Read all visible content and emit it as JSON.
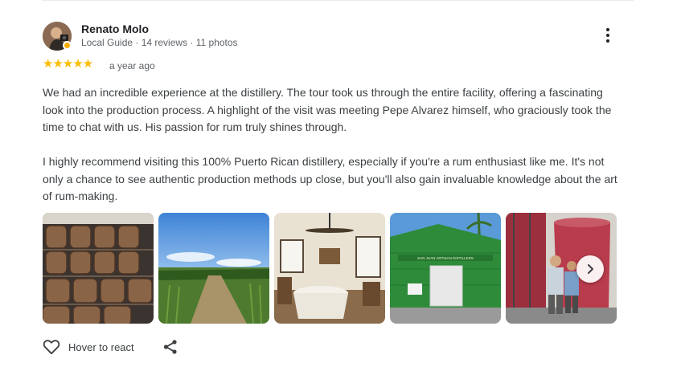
{
  "review": {
    "author": "Renato Molo",
    "meta": "Local Guide · 14 reviews · 11 photos",
    "rating": 5,
    "stars": "★★★★★",
    "date": "a year ago",
    "text": "We had an incredible experience at the distillery. The tour took us through the entire facility, offering a fascinating look into the production process. A highlight of the visit was meeting Pepe Alvarez himself, who graciously took the time to chat with us. His passion for rum truly shines through.\n\nI highly recommend visiting this 100% Puerto Rican distillery, especially if you're a rum enthusiast like me. It's not only a chance to see authentic production methods up close, but you'll also gain invaluable knowledge about the art of rum-making.",
    "building_sign": "SAN JUAN ARTISAN DISTILLERS"
  },
  "actions": {
    "react_label": "Hover to react",
    "react_icon": "heart-outline-icon",
    "share_icon": "share-icon",
    "more_icon": "more-vert-icon",
    "next_icon": "chevron-right-icon"
  },
  "colors": {
    "star": "#fbbc04",
    "text": "#3c4043",
    "secondary": "#5f6368",
    "building_green": "#2e8b3a"
  }
}
